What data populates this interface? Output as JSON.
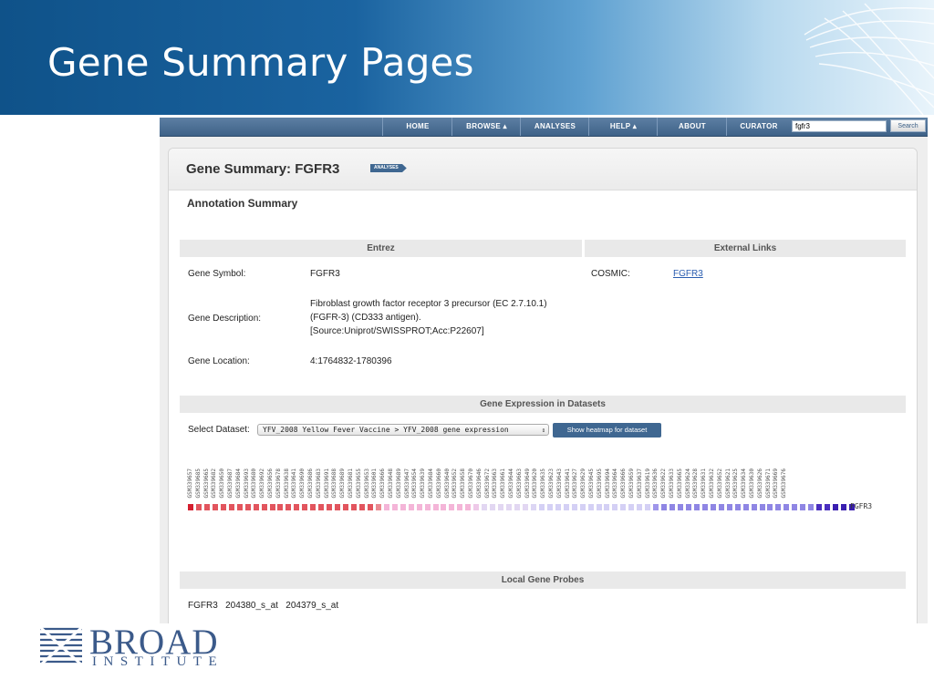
{
  "slide": {
    "title": "Gene Summary Pages"
  },
  "colors": {
    "header_dark": "#0f5289",
    "nav": "#4a6e94",
    "accent": "#3f6791",
    "link": "#2a5db0"
  },
  "nav": {
    "items": [
      "HOME",
      "BROWSE ▴",
      "ANALYSES",
      "HELP ▴",
      "ABOUT",
      "CURATOR"
    ],
    "search_value": "fgfr3",
    "search_button": "Search"
  },
  "page": {
    "title": "Gene Summary: FGFR3",
    "tag": "ANALYSES",
    "section": "Annotation Summary"
  },
  "entrez": {
    "header": "Entrez",
    "symbol_label": "Gene Symbol:",
    "symbol_value": "FGFR3",
    "desc_label": "Gene Description:",
    "desc_lines": [
      "Fibroblast growth factor receptor 3 precursor (EC 2.7.10.1)",
      "(FGFR-3) (CD333 antigen).",
      "[Source:Uniprot/SWISSPROT;Acc:P22607]"
    ],
    "location_label": "Gene Location:",
    "location_value": "4:1764832-1780396"
  },
  "external": {
    "header": "External Links",
    "label": "COSMIC:",
    "link": "FGFR3"
  },
  "expression": {
    "header": "Gene Expression in Datasets",
    "select_label": "Select Dataset:",
    "select_value": "YFV_2008 Yellow Fever Vaccine > YFV_2008 gene expression",
    "button": "Show heatmap for dataset",
    "gene": "FGFR3",
    "samples": [
      "GSM339657",
      "GSM339685",
      "GSM339665",
      "GSM339682",
      "GSM339650",
      "GSM339687",
      "GSM339684",
      "GSM339693",
      "GSM339680",
      "GSM339692",
      "GSM339656",
      "GSM339678",
      "GSM339638",
      "GSM339641",
      "GSM339690",
      "GSM339686",
      "GSM339683",
      "GSM339691",
      "GSM339688",
      "GSM339689",
      "GSM339681",
      "GSM339655",
      "GSM339653",
      "GSM339601",
      "GSM339666",
      "GSM339648",
      "GSM339689",
      "GSM339647",
      "GSM339654",
      "GSM339639",
      "GSM339684",
      "GSM339660",
      "GSM339640",
      "GSM339652",
      "GSM339658",
      "GSM339670",
      "GSM339646",
      "GSM339672",
      "GSM339663",
      "GSM339661",
      "GSM339644",
      "GSM339663",
      "GSM339649",
      "GSM339620",
      "GSM339635",
      "GSM339623",
      "GSM339643",
      "GSM339641",
      "GSM339627",
      "GSM339629",
      "GSM339645",
      "GSM339695",
      "GSM339694",
      "GSM339664",
      "GSM339666",
      "GSM339659",
      "GSM339637",
      "GSM339619",
      "GSM339636",
      "GSM339622",
      "GSM339633",
      "GSM339665",
      "GSM339624",
      "GSM339628",
      "GSM339631",
      "GSM339632",
      "GSM339652",
      "GSM339621",
      "GSM339625",
      "GSM339634",
      "GSM339630",
      "GSM339626",
      "GSM339671",
      "GSM339669",
      "GSM339676"
    ],
    "heat_colors": [
      "#d41f2f",
      "#e2555e",
      "#e2555e",
      "#e2555e",
      "#e2555e",
      "#e2555e",
      "#e2555e",
      "#e2555e",
      "#e2555e",
      "#e2555e",
      "#e2555e",
      "#e2555e",
      "#e2555e",
      "#e2555e",
      "#e2555e",
      "#e2555e",
      "#e2555e",
      "#e2555e",
      "#e2555e",
      "#e2555e",
      "#e2555e",
      "#e2555e",
      "#e2555e",
      "#ea8a92",
      "#f4b5d8",
      "#f4b5d8",
      "#f4b5d8",
      "#f4b5d8",
      "#f4b5d8",
      "#f4b5d8",
      "#f4b5d8",
      "#f4b5d8",
      "#f4b5d8",
      "#f4b5d8",
      "#f4b5d8",
      "#eec9e8",
      "#e2d7f2",
      "#e2d7f2",
      "#e2d7f2",
      "#e2d7f2",
      "#e2d7f2",
      "#e2d7f2",
      "#dcd6f4",
      "#d4d0f5",
      "#d4d0f5",
      "#d4d0f5",
      "#d4d0f5",
      "#d4d0f5",
      "#d4d0f5",
      "#d4d0f5",
      "#d4d0f5",
      "#d4d0f5",
      "#d4d0f5",
      "#d4d0f5",
      "#d4d0f5",
      "#d4d0f5",
      "#d4d0f5",
      "#9f96ea",
      "#8f86e4",
      "#8f86e4",
      "#8f86e4",
      "#8f86e4",
      "#8f86e4",
      "#8f86e4",
      "#8f86e4",
      "#8f86e4",
      "#8f86e4",
      "#8f86e4",
      "#8f86e4",
      "#8f86e4",
      "#8f86e4",
      "#8f86e4",
      "#8f86e4",
      "#8f86e4",
      "#8f86e4",
      "#8f86e4",
      "#8f86e4",
      "#4a2fbf",
      "#4a2fbf",
      "#3a1fb0",
      "#3a1fb0",
      "#3a1fb0"
    ]
  },
  "probes": {
    "header": "Local Gene Probes",
    "text": "FGFR3   204380_s_at   204379_s_at"
  },
  "logo": {
    "word": "BROAD",
    "sub": "INSTITUTE"
  }
}
